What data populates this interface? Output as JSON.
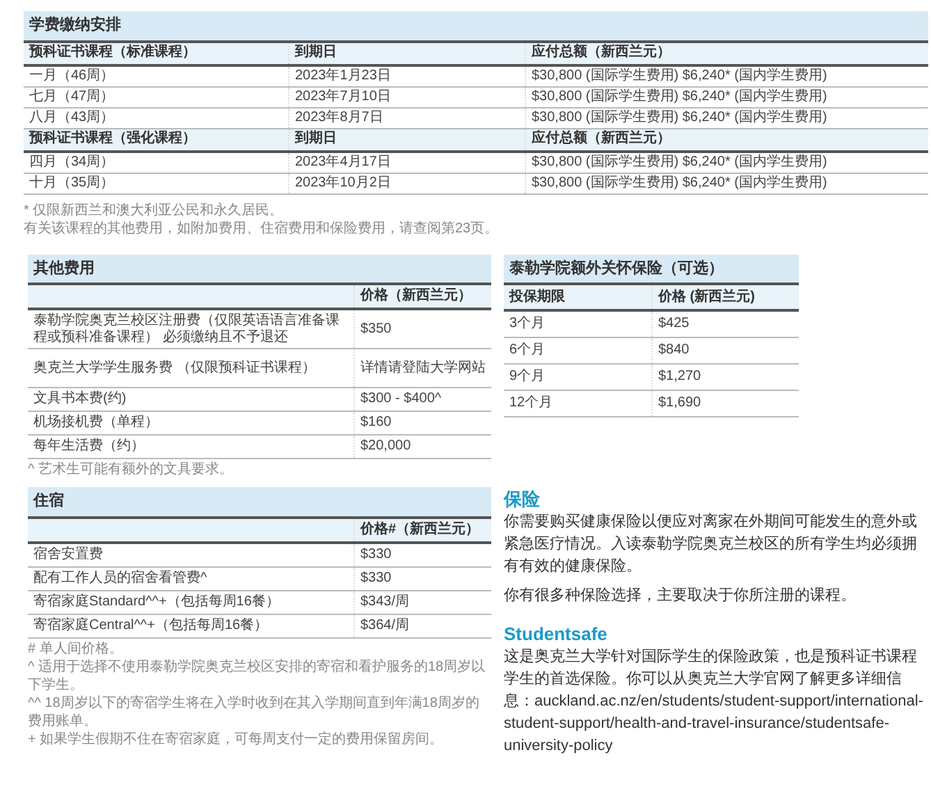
{
  "fee_schedule": {
    "title": "学费缴纳安排",
    "sections": [
      {
        "header": [
          "预科证书课程（标准课程）",
          "到期日",
          "应付总额（新西兰元）"
        ],
        "rows": [
          [
            "一月（46周）",
            "2023年1月23日",
            "$30,800 (国际学生费用) $6,240* (国内学生费用)"
          ],
          [
            "七月（47周）",
            "2023年7月10日",
            "$30,800 (国际学生费用) $6,240* (国内学生费用)"
          ],
          [
            "八月（43周）",
            "2023年8月7日",
            "$30,800 (国际学生费用) $6,240* (国内学生费用)"
          ]
        ]
      },
      {
        "header": [
          "预科证书课程（强化课程）",
          "到期日",
          "应付总额（新西兰元）"
        ],
        "rows": [
          [
            "四月（34周）",
            "2023年4月17日",
            "$30,800 (国际学生费用) $6,240* (国内学生费用)"
          ],
          [
            "十月（35周）",
            "2023年10月2日",
            "$30,800 (国际学生费用) $6,240* (国内学生费用)"
          ]
        ]
      }
    ],
    "footnotes": [
      "* 仅限新西兰和澳大利亚公民和永久居民。",
      "有关该课程的其他费用，如附加费用、住宿费用和保险费用，请查阅第23页。"
    ]
  },
  "other_fees": {
    "title": "其他费用",
    "price_header": "价格（新西兰元）",
    "rows": [
      [
        "泰勒学院奥克兰校区注册费（仅限英语语言准备课程或预科准备课程） 必须缴纳且不予退还",
        "$350"
      ],
      [
        "奥克兰大学学生服务费 （仅限预科证书课程）",
        "详情请登陆大学网站"
      ],
      [
        "文具书本费(约)",
        "$300 - $400^"
      ],
      [
        "机场接机费（单程）",
        "$160"
      ],
      [
        "每年生活费（约）",
        "$20,000"
      ]
    ],
    "footnotes": [
      "^ 艺术生可能有额外的文具要求。"
    ]
  },
  "insurance_table": {
    "title": "泰勒学院额外关怀保险（可选）",
    "columns": [
      "投保期限",
      "价格 (新西兰元)"
    ],
    "rows": [
      [
        "3个月",
        "$425"
      ],
      [
        "6个月",
        "$840"
      ],
      [
        "9个月",
        "$1,270"
      ],
      [
        "12个月",
        "$1,690"
      ]
    ]
  },
  "accommodation": {
    "title": "住宿",
    "price_header": "价格#（新西兰元）",
    "rows": [
      [
        "宿舍安置费",
        "$330"
      ],
      [
        "配有工作人员的宿舍看管费^",
        "$330"
      ],
      [
        "寄宿家庭Standard^^+（包括每周16餐）",
        "$343/周"
      ],
      [
        "寄宿家庭Central^^+（包括每周16餐）",
        "$364/周"
      ]
    ],
    "footnotes": [
      "# 单人间价格。",
      "^ 适用于选择不使用泰勒学院奥克兰校区安排的寄宿和看护服务的18周岁以下学生。",
      "^^ 18周岁以下的寄宿学生将在入学时收到在其入学期间直到年满18周岁的费用账单。",
      "+ 如果学生假期不住在寄宿家庭，可每周支付一定的费用保留房间。"
    ]
  },
  "info_sections": [
    {
      "heading": "保险",
      "paragraphs": [
        "你需要购买健康保险以便应对离家在外期间可能发生的意外或紧急医疗情况。入读泰勒学院奥克兰校区的所有学生均必须拥有有效的健康保险。",
        "你有很多种保险选择，主要取决于你所注册的课程。"
      ]
    },
    {
      "heading": "Studentsafe",
      "paragraphs": [
        "这是奥克兰大学针对国际学生的保险政策，也是预科证书课程学生的首选保险。你可以从奥克兰大学官网了解更多详细信息：auckland.ac.nz/en/students/student-support/international-student-support/health-and-travel-insurance/studentsafe-university-policy"
      ]
    }
  ]
}
